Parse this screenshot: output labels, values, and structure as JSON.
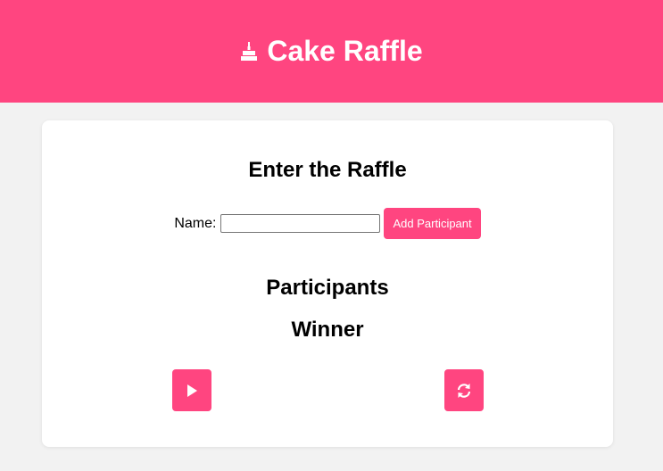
{
  "header": {
    "title": "Cake Raffle",
    "icon": "cake-icon"
  },
  "raffle": {
    "title": "Enter the Raffle",
    "name_label": "Name:",
    "name_value": "",
    "add_button_label": "Add Participant"
  },
  "participants": {
    "title": "Participants",
    "items": []
  },
  "winner": {
    "title": "Winner"
  },
  "controls": {
    "play_icon": "play-icon",
    "reset_icon": "refresh-icon"
  },
  "colors": {
    "accent": "#ff4580",
    "background": "#f2f2f2",
    "card": "#ffffff"
  }
}
